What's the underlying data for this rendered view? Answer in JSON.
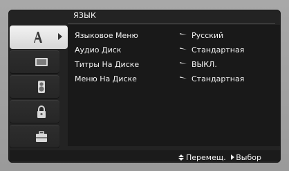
{
  "menu": {
    "title": "ЯЗЫК"
  },
  "tabs": [
    {
      "name": "language-tab",
      "icon": "language-a-icon",
      "active": true
    },
    {
      "name": "display-tab",
      "icon": "tv-icon",
      "active": false
    },
    {
      "name": "audio-tab",
      "icon": "speaker-icon",
      "active": false
    },
    {
      "name": "lock-tab",
      "icon": "lock-icon",
      "active": false
    },
    {
      "name": "other-tab",
      "icon": "briefcase-icon",
      "active": false
    }
  ],
  "settings": [
    {
      "label": "Языковое Меню",
      "value": "Русский"
    },
    {
      "label": "Аудио Диск",
      "value": "Стандартная"
    },
    {
      "label": "Титры На Диске",
      "value": "ВЫКЛ."
    },
    {
      "label": "Меню На Диске",
      "value": "Стандартная"
    }
  ],
  "footer": {
    "move_label": "Перемещ.",
    "select_label": "Выбор"
  }
}
